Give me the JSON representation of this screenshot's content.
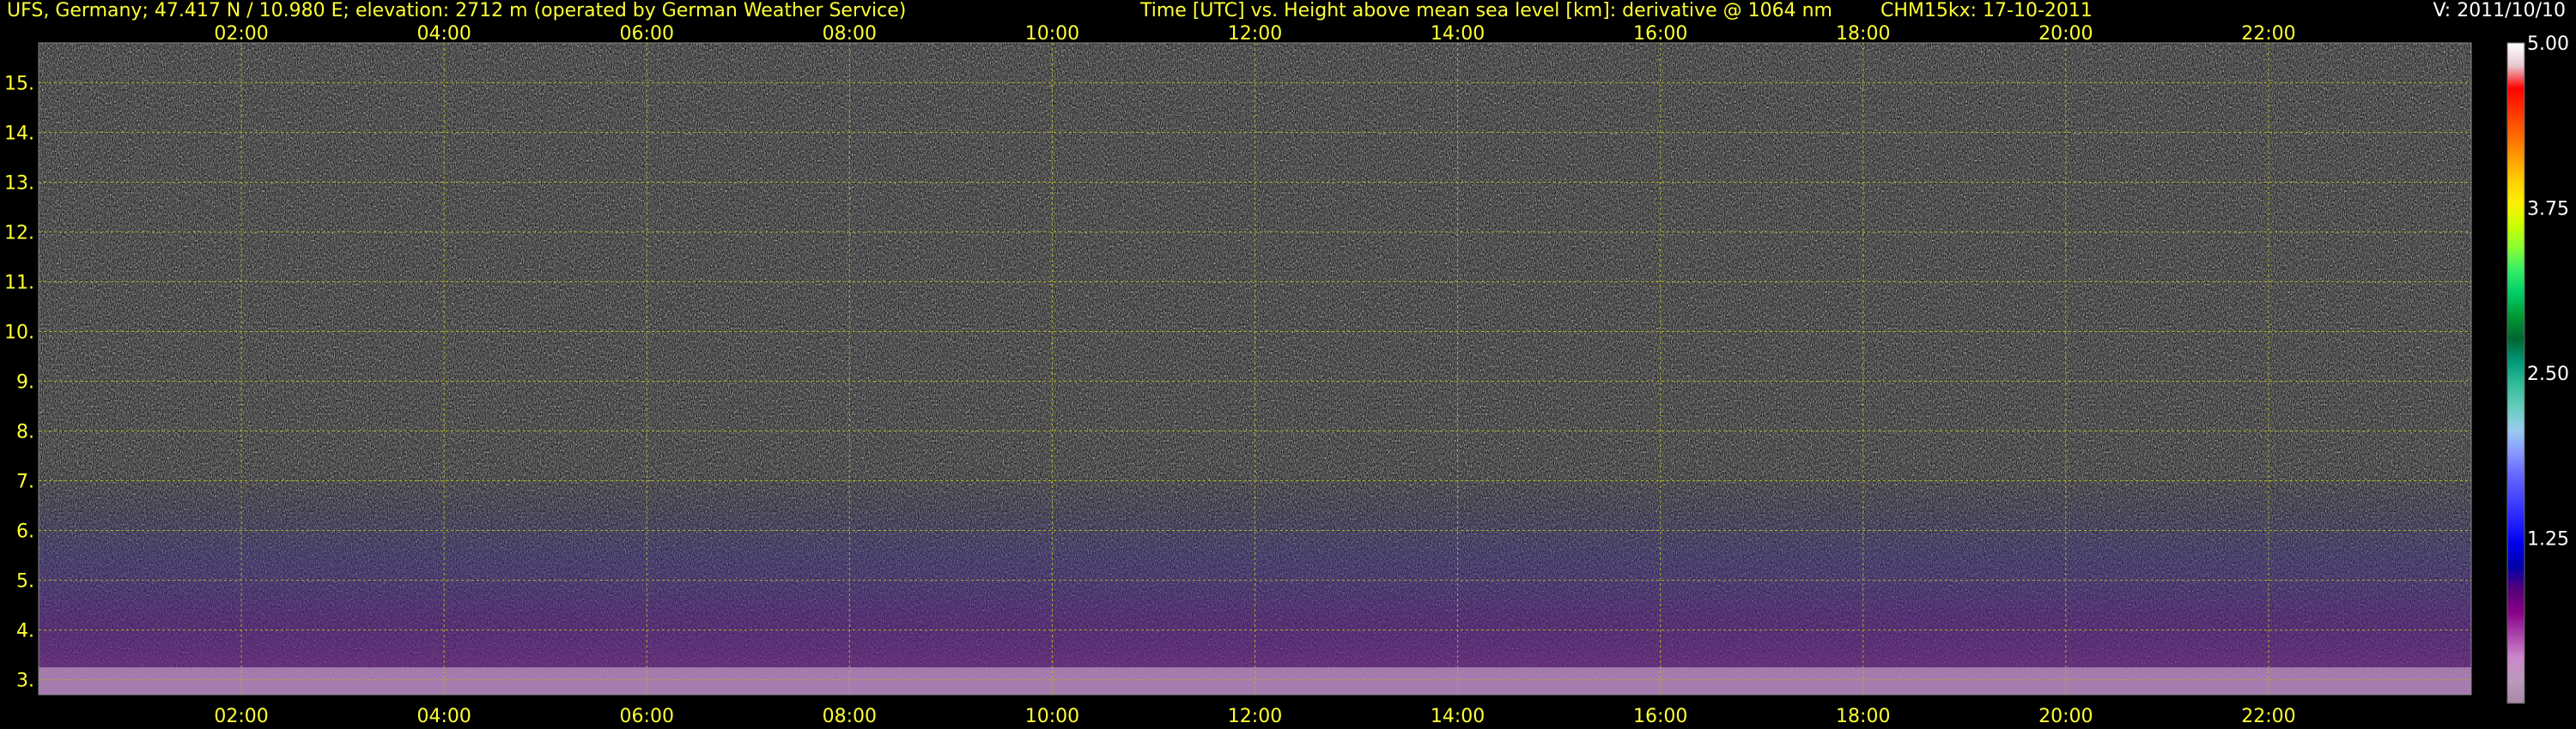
{
  "header": {
    "left": "UFS, Germany; 47.417 N / 10.980 E; elevation: 2712 m  (operated by German Weather Service)",
    "center": "Time [UTC] vs. Height above mean sea level [km]: derivative @ 1064 nm",
    "right": "CHM15kx: 17-10-2011",
    "version": "V: 2011/10/10"
  },
  "chart_data": {
    "type": "heatmap",
    "title": "Time [UTC] vs. Height above mean sea level [km]: derivative @ 1064 nm",
    "xlabel": "",
    "ylabel": "",
    "x_ticks": [
      "02:00",
      "04:00",
      "06:00",
      "08:00",
      "10:00",
      "12:00",
      "14:00",
      "16:00",
      "18:00",
      "20:00",
      "22:00"
    ],
    "x_tick_hours": [
      2,
      4,
      6,
      8,
      10,
      12,
      14,
      16,
      18,
      20,
      22
    ],
    "xlim_hours": [
      0,
      24
    ],
    "y_ticks": [
      "3.",
      "4.",
      "5.",
      "6.",
      "7.",
      "8.",
      "9.",
      "10.",
      "11.",
      "12.",
      "13.",
      "14.",
      "15."
    ],
    "y_tick_values": [
      3,
      4,
      5,
      6,
      7,
      8,
      9,
      10,
      11,
      12,
      13,
      14,
      15
    ],
    "ylim_km": [
      2.7,
      15.8
    ],
    "grid": true,
    "colorbar": {
      "labels": [
        "5.00",
        "3.75",
        "2.50",
        "1.25"
      ],
      "values": [
        5.0,
        3.75,
        2.5,
        1.25
      ],
      "range": [
        0,
        5.0
      ],
      "colors": [
        "#ffffff",
        "#e8c8d0",
        "#ff0000",
        "#ff3300",
        "#ff6600",
        "#ff9900",
        "#ffcc00",
        "#ffee00",
        "#ccff00",
        "#88ff33",
        "#33ee66",
        "#00cc66",
        "#009933",
        "#006633",
        "#009977",
        "#33bb99",
        "#66ccbb",
        "#99ccee",
        "#8899ff",
        "#6666ff",
        "#4444ff",
        "#2222ff",
        "#0000ee",
        "#0000aa",
        "#550077",
        "#880088",
        "#aa44aa",
        "#cc88cc",
        "#bb99bb",
        "#aa88aa"
      ]
    },
    "colors": {
      "axis_text": "#ffff33",
      "grid": "#b0b020",
      "background": "#000000"
    }
  }
}
